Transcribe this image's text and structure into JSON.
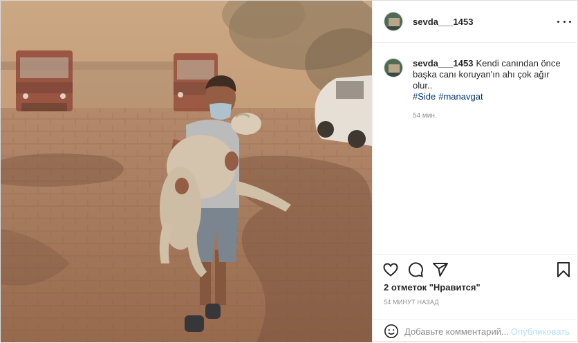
{
  "post": {
    "username": "sevda___1453",
    "caption": "Kendi canından önce başka canı koruyan'ın ahı çok ağır olur..",
    "hashtags": [
      "#Side",
      "#manavgat"
    ],
    "comment_age": "54 мин.",
    "likes_text": "2 отметок \"Нравится\"",
    "posted_time": "54 МИНУТ НАЗАД",
    "comment_placeholder": "Добавьте комментарий...",
    "publish_label": "Опубликовать"
  },
  "photo": {
    "subject": "boy in face mask carrying a sheep through smoke",
    "colors": {
      "sky": "#c4a07c",
      "ground": "#a37456",
      "shadow": "#6e4a33"
    }
  },
  "icons": [
    "more-icon",
    "heart-icon",
    "comment-icon",
    "share-icon",
    "bookmark-icon",
    "emoji-icon"
  ]
}
